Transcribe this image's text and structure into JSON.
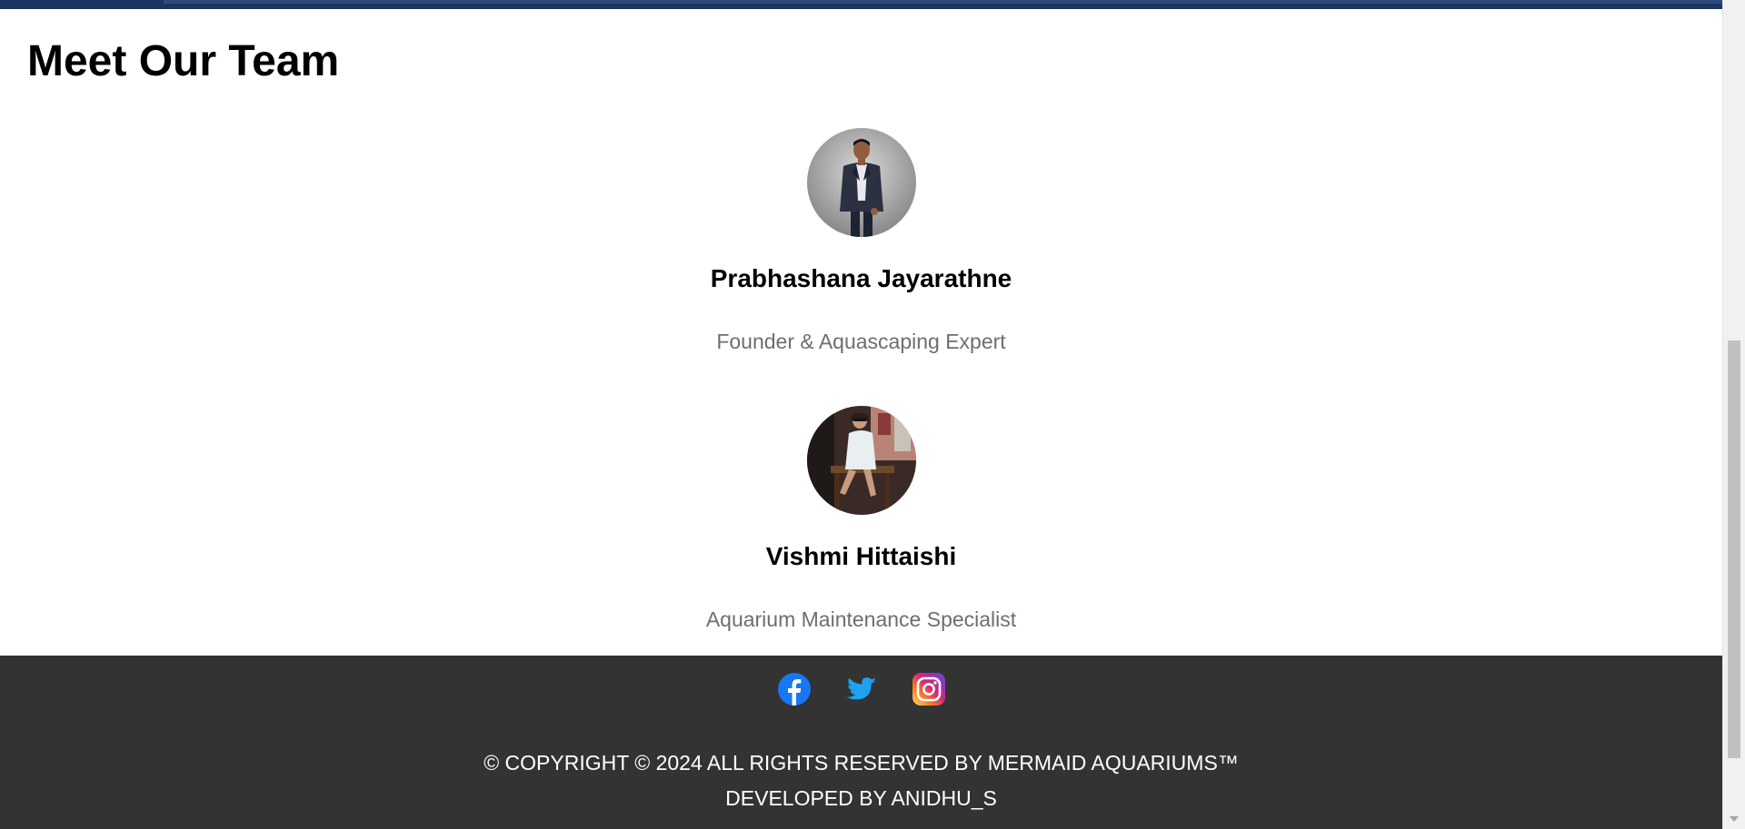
{
  "section": {
    "title": "Meet Our Team"
  },
  "team": [
    {
      "name": "Prabhashana Jayarathne",
      "role": "Founder & Aquascaping Expert",
      "avatar_icon": "person-photo-suit"
    },
    {
      "name": "Vishmi Hittaishi",
      "role": "Aquarium Maintenance Specialist",
      "avatar_icon": "person-photo-seated"
    }
  ],
  "footer": {
    "social": [
      {
        "name": "facebook",
        "icon": "facebook-icon",
        "color": "#1877f2"
      },
      {
        "name": "twitter",
        "icon": "twitter-icon",
        "color": "#1da1f2"
      },
      {
        "name": "instagram",
        "icon": "instagram-icon",
        "color": "#e1306c"
      }
    ],
    "copyright": "© COPYRIGHT © 2024 ALL RIGHTS RESERVED BY MERMAID AQUARIUMS™",
    "developed_by": "DEVELOPED BY ANIDHU_S"
  },
  "colors": {
    "footer_bg": "#333333",
    "top_strip": "#1c355e",
    "role_text": "#6e6e6e"
  }
}
